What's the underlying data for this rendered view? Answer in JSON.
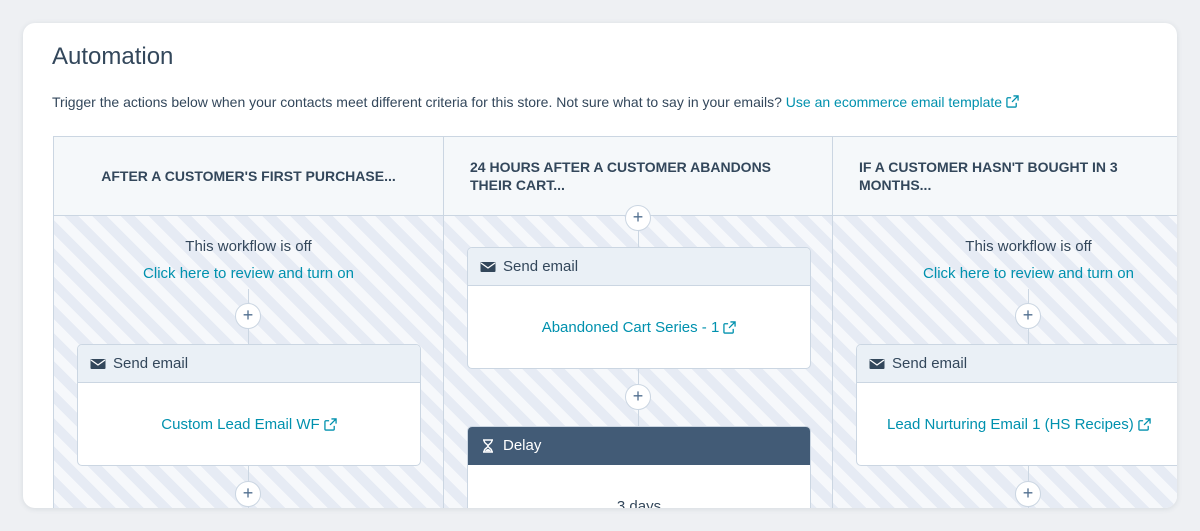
{
  "page": {
    "title": "Automation",
    "description": "Trigger the actions below when your contacts meet different criteria for this store. Not sure what to say in your emails?",
    "template_link": "Use an ecommerce email template"
  },
  "columns": [
    {
      "header": "AFTER A CUSTOMER'S FIRST PURCHASE...",
      "status_off": "This workflow is off",
      "review_link": "Click here to review and turn on",
      "action_type": "Send email",
      "action_link": "Custom Lead Email WF"
    },
    {
      "header": "24 HOURS AFTER A CUSTOMER ABANDONS THEIR CART...",
      "action_type": "Send email",
      "action_link": "Abandoned Cart Series - 1",
      "delay_label": "Delay",
      "delay_value": "3 days"
    },
    {
      "header": "IF A CUSTOMER HASN'T BOUGHT IN 3 MONTHS...",
      "status_off": "This workflow is off",
      "review_link": "Click here to review and turn on",
      "action_type": "Send email",
      "action_link": "Lead Nurturing Email 1 (HS Recipes)"
    }
  ],
  "icons": {
    "plus": "+",
    "email": "envelope-icon",
    "delay": "hourglass-icon",
    "external": "external-link-icon"
  },
  "colors": {
    "link": "#0091ae",
    "text": "#33475b",
    "border": "#cbd6e2",
    "delay_header": "#425b76"
  }
}
